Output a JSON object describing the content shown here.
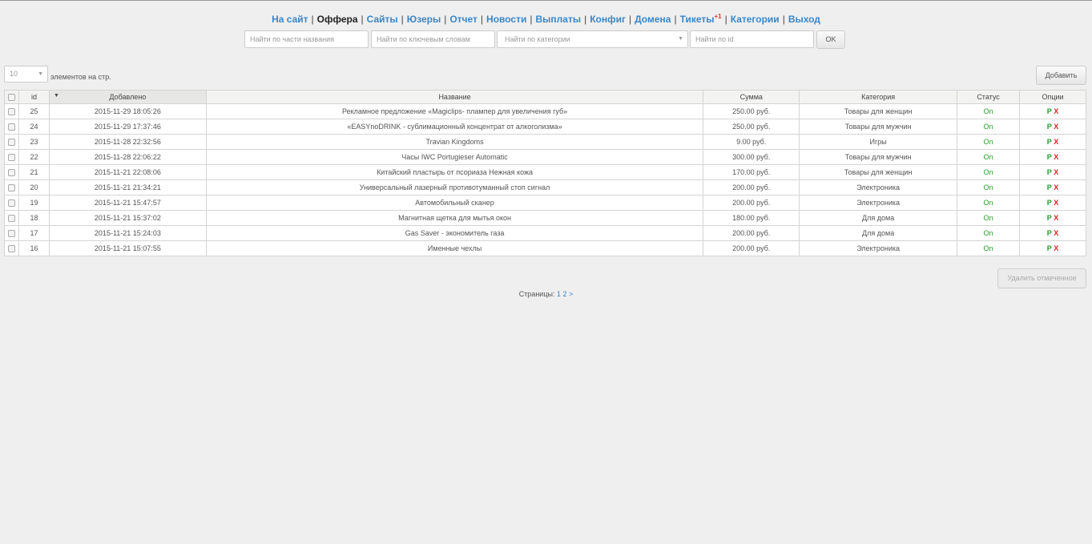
{
  "nav": {
    "items": [
      {
        "label": "На сайт"
      },
      {
        "label": "Оффера",
        "active": true
      },
      {
        "label": "Сайты"
      },
      {
        "label": "Юзеры"
      },
      {
        "label": "Отчет"
      },
      {
        "label": "Новости"
      },
      {
        "label": "Выплаты"
      },
      {
        "label": "Конфиг"
      },
      {
        "label": "Домена"
      },
      {
        "label": "Тикеты",
        "badge": "+1"
      },
      {
        "label": "Категории"
      },
      {
        "label": "Выход"
      }
    ],
    "separator": "|"
  },
  "search": {
    "name_placeholder": "Найти по части названия",
    "keywords_placeholder": "Найти по ключевым словам",
    "category_placeholder": "Найти по категории",
    "id_placeholder": "Найти по id",
    "ok_label": "OK"
  },
  "per_page": {
    "value": "10",
    "label": "элементов на стр."
  },
  "add_label": "Добавить",
  "table": {
    "headers": [
      "id",
      "Добавлено",
      "Название",
      "Сумма",
      "Категория",
      "Статус",
      "Опции"
    ],
    "rows": [
      {
        "id": "25",
        "date": "2015-11-29 18:05:26",
        "name": "Рекламное предложение «Magiclips- плампер для увеличения губ»",
        "sum": "250.00 руб.",
        "category": "Товары для женщин",
        "status": "On"
      },
      {
        "id": "24",
        "date": "2015-11-29 17:37:46",
        "name": "«EASYnoDRINK - сублимационный концентрат от алкоголизма»",
        "sum": "250.00 руб.",
        "category": "Товары для мужчин",
        "status": "On"
      },
      {
        "id": "23",
        "date": "2015-11-28 22:32:56",
        "name": "Travian Kingdoms",
        "sum": "9.00 руб.",
        "category": "Игры",
        "status": "On"
      },
      {
        "id": "22",
        "date": "2015-11-28 22:06:22",
        "name": "Часы IWC Portugieser Automatic",
        "sum": "300.00 руб.",
        "category": "Товары для мужчин",
        "status": "On"
      },
      {
        "id": "21",
        "date": "2015-11-21 22:08:06",
        "name": "Китайский пластырь от псориаза Нежная кожа",
        "sum": "170.00 руб.",
        "category": "Товары для женщин",
        "status": "On"
      },
      {
        "id": "20",
        "date": "2015-11-21 21:34:21",
        "name": "Универсальный лазерный противотуманный стоп сигнал",
        "sum": "200.00 руб.",
        "category": "Электроника",
        "status": "On"
      },
      {
        "id": "19",
        "date": "2015-11-21 15:47:57",
        "name": "Автомобильный сканер",
        "sum": "200.00 руб.",
        "category": "Электроника",
        "status": "On"
      },
      {
        "id": "18",
        "date": "2015-11-21 15:37:02",
        "name": "Магнитная щетка для мытья окон",
        "sum": "180.00 руб.",
        "category": "Для дома",
        "status": "On"
      },
      {
        "id": "17",
        "date": "2015-11-21 15:24:03",
        "name": "Gas Saver - экономитель газа",
        "sum": "200.00 руб.",
        "category": "Для дома",
        "status": "On"
      },
      {
        "id": "16",
        "date": "2015-11-21 15:07:55",
        "name": "Именные чехлы",
        "sum": "200.00 руб.",
        "category": "Электроника",
        "status": "On"
      }
    ],
    "option_edit": "P",
    "option_delete": "X"
  },
  "delete_selected_label": "Удалить отмеченное",
  "pagination": {
    "label": "Страницы:",
    "current": "1",
    "next_page": "2",
    "next": ">"
  },
  "colors": {
    "link": "#3a86c8",
    "on": "#2a9a2a",
    "delete": "#e02020"
  }
}
